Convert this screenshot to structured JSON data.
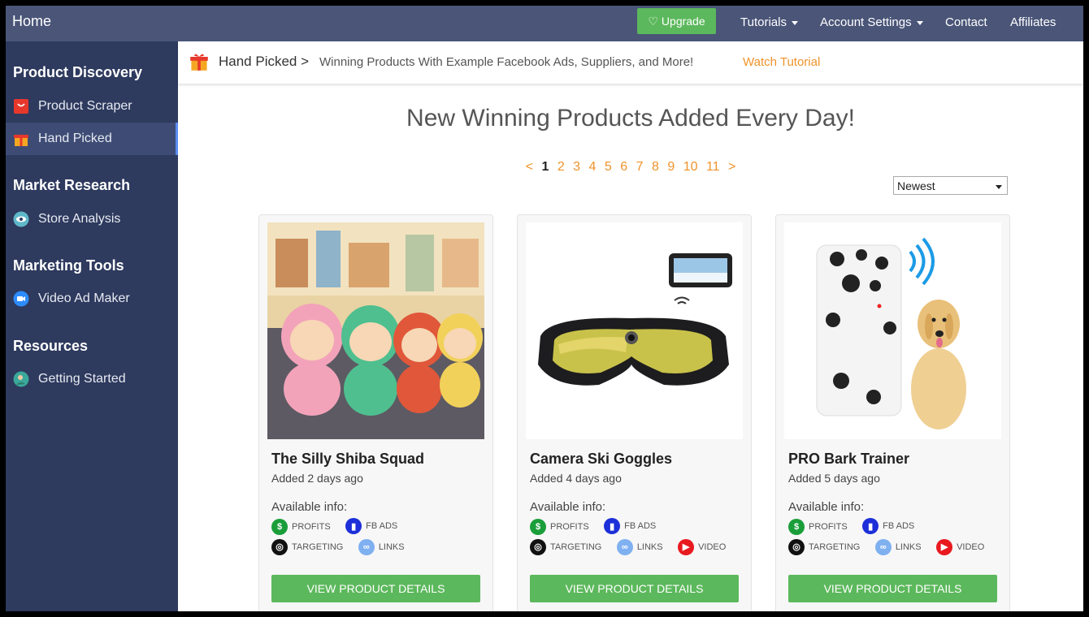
{
  "topbar": {
    "home": "Home",
    "upgrade": "Upgrade",
    "nav": [
      "Tutorials",
      "Account Settings",
      "Contact",
      "Affiliates"
    ]
  },
  "sidebar": {
    "sections": [
      {
        "heading": "Product Discovery",
        "items": [
          "Product Scraper",
          "Hand Picked"
        ]
      },
      {
        "heading": "Market Research",
        "items": [
          "Store Analysis"
        ]
      },
      {
        "heading": "Marketing Tools",
        "items": [
          "Video Ad Maker"
        ]
      },
      {
        "heading": "Resources",
        "items": [
          "Getting Started"
        ]
      }
    ]
  },
  "breadcrumb": {
    "main": "Hand Picked >",
    "sub": "Winning Products With Example Facebook Ads, Suppliers, and More!",
    "link": "Watch Tutorial"
  },
  "headline": "New Winning Products Added Every Day!",
  "pager": {
    "prev": "<",
    "pages": [
      "1",
      "2",
      "3",
      "4",
      "5",
      "6",
      "7",
      "8",
      "9",
      "10",
      "11"
    ],
    "next": ">",
    "current": "1"
  },
  "sort": {
    "value": "Newest"
  },
  "info_labels": {
    "avail": "Available info:",
    "profits": "PROFITS",
    "fbads": "FB ADS",
    "targeting": "TARGETING",
    "links": "LINKS",
    "video": "VIDEO"
  },
  "button_label": "VIEW PRODUCT DETAILS",
  "products": [
    {
      "title": "The Silly Shiba Squad",
      "added": "Added 2 days ago",
      "has_video": false
    },
    {
      "title": "Camera Ski Goggles",
      "added": "Added 4 days ago",
      "has_video": true
    },
    {
      "title": "PRO Bark Trainer",
      "added": "Added 5 days ago",
      "has_video": true
    }
  ],
  "colors": {
    "topbar": "#4a5578",
    "sidebar": "#2e3a5e",
    "accent": "#f0932b",
    "green": "#5cb85c"
  }
}
